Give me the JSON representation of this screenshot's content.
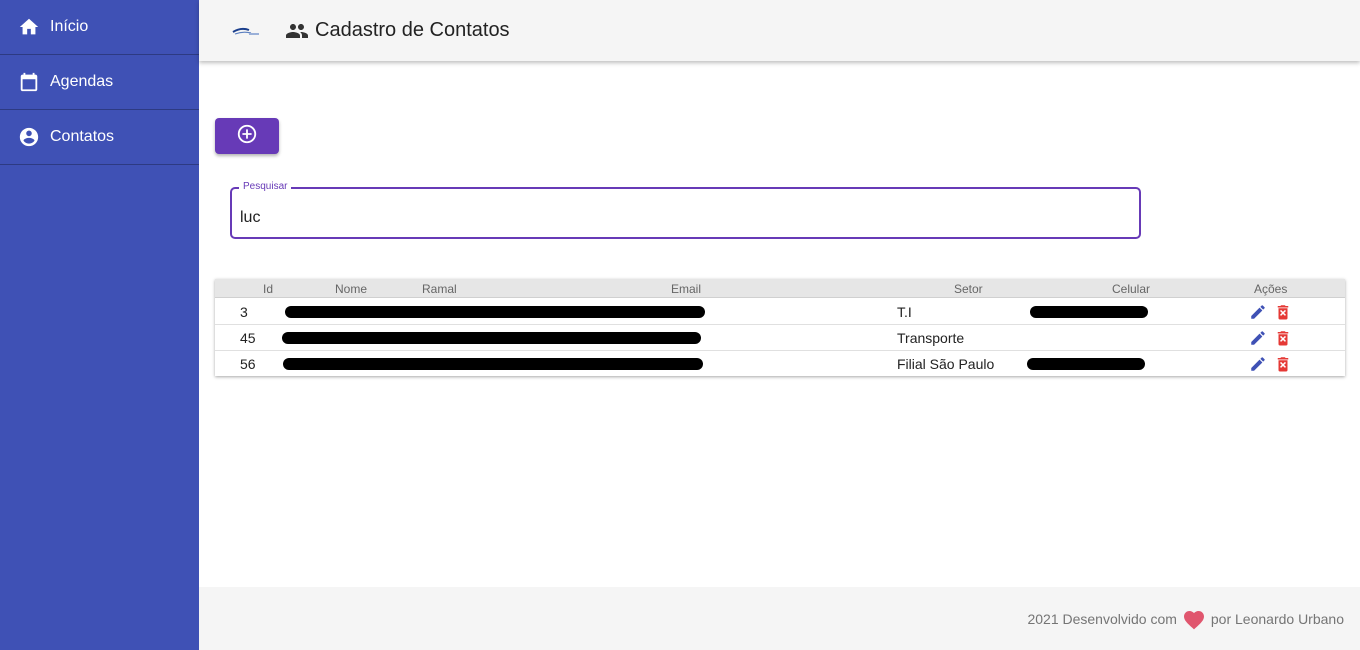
{
  "sidebar": {
    "items": [
      {
        "label": "Início",
        "icon": "home-icon"
      },
      {
        "label": "Agendas",
        "icon": "calendar-icon"
      },
      {
        "label": "Contatos",
        "icon": "account-circle-icon"
      }
    ]
  },
  "header": {
    "title": "Cadastro de Contatos",
    "title_icon": "people-icon",
    "logo": "company-logo"
  },
  "add_button": {
    "icon": "add-circle-icon"
  },
  "search": {
    "label": "Pesquisar",
    "value": "luc"
  },
  "table": {
    "headers": [
      "Id",
      "Nome",
      "Ramal",
      "Email",
      "Setor",
      "Celular",
      "Ações"
    ],
    "rows": [
      {
        "id": "3",
        "setor": "T.I"
      },
      {
        "id": "45",
        "setor": "Transporte"
      },
      {
        "id": "56",
        "setor": "Filial São Paulo"
      }
    ]
  },
  "footer": {
    "before": "2021 Desenvolvido com",
    "after": "por Leonardo Urbano"
  },
  "colors": {
    "sidebar": "#3f51b5",
    "primary": "#673ab7",
    "edit_icon": "#3f51b5",
    "delete_icon": "#e53935",
    "heart": "#e0566e"
  }
}
